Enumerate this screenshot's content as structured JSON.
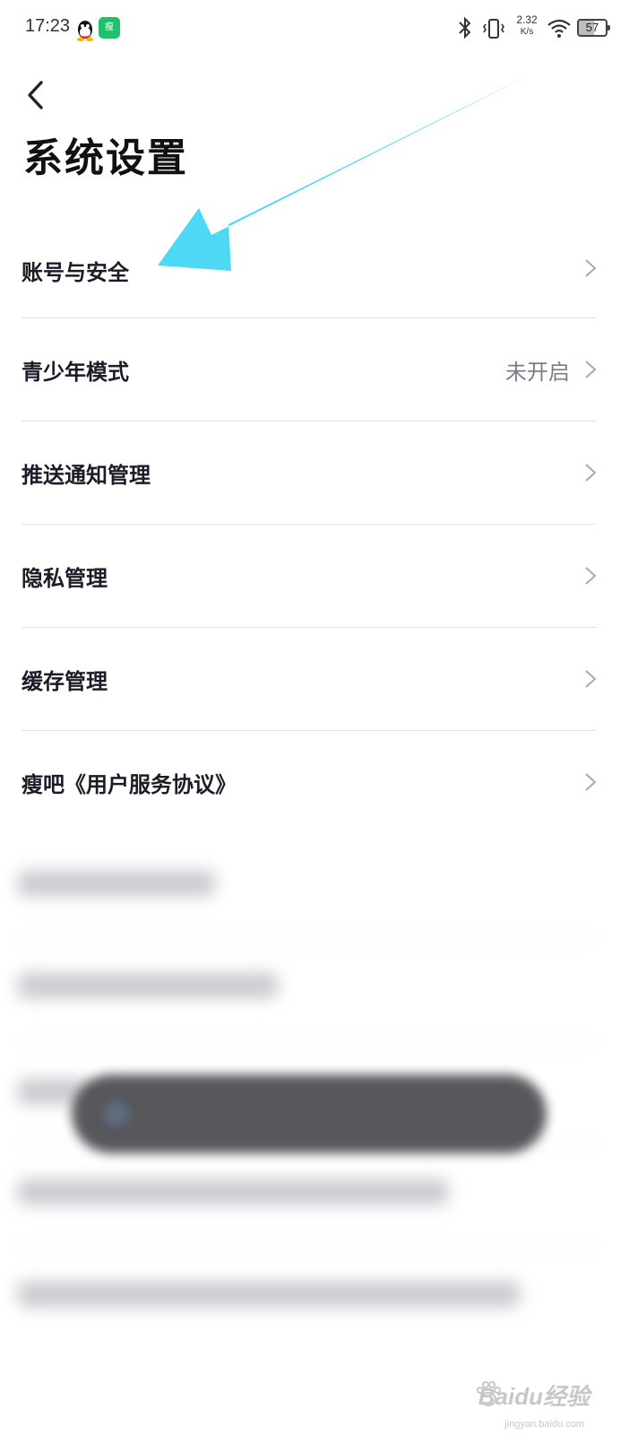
{
  "status_bar": {
    "time": "17:23",
    "net_speed_value": "2.32",
    "net_speed_unit": "K/s",
    "battery": "57",
    "icons": [
      "qq-icon",
      "app-badge-icon",
      "bluetooth-icon",
      "vibrate-icon",
      "wifi-icon",
      "battery-icon"
    ]
  },
  "header": {
    "back_icon": "chevron-left-icon",
    "title": "系统设置"
  },
  "settings": {
    "items": [
      {
        "label": "账号与安全",
        "value": ""
      },
      {
        "label": "青少年模式",
        "value": "未开启"
      },
      {
        "label": "推送通知管理",
        "value": ""
      },
      {
        "label": "隐私管理",
        "value": ""
      },
      {
        "label": "缓存管理",
        "value": ""
      },
      {
        "label": "瘦吧《用户服务协议》",
        "value": ""
      }
    ]
  },
  "colors": {
    "annotation_arrow": "#4dd8f5",
    "title_text": "#111111",
    "secondary_text": "#7c7c88",
    "app_badge": "#1fc16b"
  },
  "watermark": {
    "text": "Baidu经验",
    "sub": "jingyan.baidu.com"
  }
}
